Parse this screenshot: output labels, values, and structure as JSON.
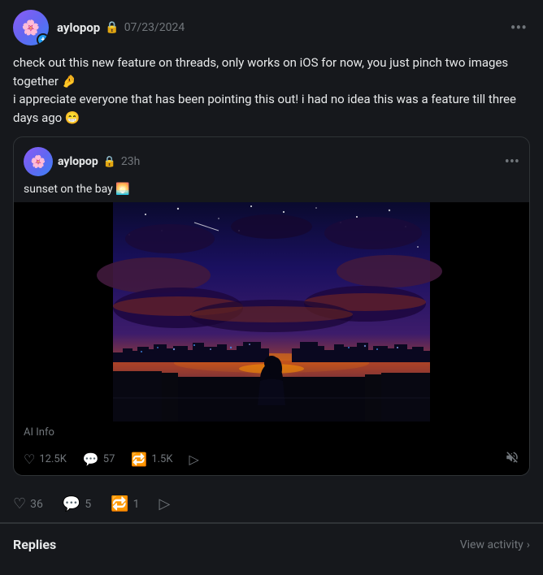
{
  "post": {
    "author": {
      "username": "aylopop",
      "avatar_emoji": "🌸",
      "verified": true,
      "has_plus": true
    },
    "date": "07/23/2024",
    "content_lines": [
      "check out this new feature on threads, only works on iOS for now, you just pinch two images together 🤌",
      "i appreciate everyone that has been pointing this out! i had no idea this was a feature till three days ago 😁"
    ],
    "more_label": "•••"
  },
  "nested_post": {
    "author": {
      "username": "aylopop",
      "avatar_emoji": "🌸",
      "verified": true
    },
    "time": "23h",
    "caption": "sunset on the bay 🌅",
    "image_alt": "Anime-style sunset scene with a figure overlooking a city bay",
    "ai_info_label": "AI Info",
    "actions": {
      "likes": "12.5K",
      "comments": "57",
      "reposts": "1.5K",
      "share_icon": "share",
      "mute_icon": "mute"
    },
    "more_label": "•••"
  },
  "outer_actions": {
    "likes": "36",
    "comments": "5",
    "reposts": "1"
  },
  "replies_section": {
    "label": "Replies",
    "view_activity": "View activity"
  }
}
